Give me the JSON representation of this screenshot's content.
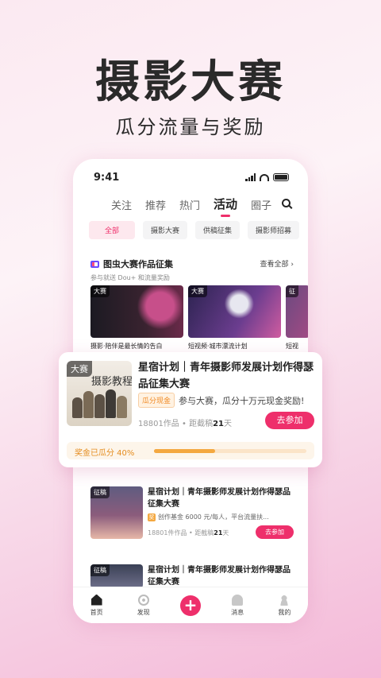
{
  "hero": {
    "title": "摄影大赛",
    "subtitle": "瓜分流量与奖励"
  },
  "status_bar": {
    "time": "9:41"
  },
  "tabs": [
    "关注",
    "推荐",
    "热门",
    "活动",
    "圈子"
  ],
  "chips": [
    "全部",
    "摄影大赛",
    "供稿征集",
    "摄影师招募"
  ],
  "section": {
    "title": "图虫大赛作品征集",
    "view_all": "查看全部 ›",
    "desc": "参与就送 Dou+ 和流量奖励"
  },
  "thumbs": [
    {
      "tag": "大赛",
      "caption": "摄影·陪伴是最长情的告白"
    },
    {
      "tag": "大赛",
      "caption": "短视频·城市漂流计划"
    },
    {
      "tag": "征",
      "caption": "短视"
    }
  ],
  "featured": {
    "tag": "大赛",
    "pic_text": "摄影教程",
    "title": "星宿计划｜青年摄影师发展计划作得瑟品征集大赛",
    "badge": "瓜分现金",
    "desc": "参与大赛，瓜分十万元现金奖励!",
    "works": "18801作品",
    "deadline_pre": "• 距截稿",
    "deadline_days": "21",
    "deadline_unit": "天",
    "join": "去参加",
    "progress_label": "奖金已瓜分 40%",
    "progress": 0.4
  },
  "items": [
    {
      "tag": "征稿",
      "title": "星宿计划｜青年摄影师发展计划作得瑟品征集大赛",
      "badge": "奖",
      "desc": "创作基金 6000 元/每人，平台流量扶...",
      "works": "18801件作品",
      "deadline_pre": "• 距截稿",
      "deadline_days": "21",
      "deadline_unit": "天",
      "join": "去参加"
    },
    {
      "tag": "征稿",
      "title": "星宿计划｜青年摄影师发展计划作得瑟品征集大赛"
    }
  ],
  "tabbar": {
    "home": "首页",
    "discover": "发现",
    "plus": "+",
    "messages": "消息",
    "me": "我的"
  },
  "colors": {
    "accent": "#ee2f6b",
    "gold": "#f4a840"
  }
}
